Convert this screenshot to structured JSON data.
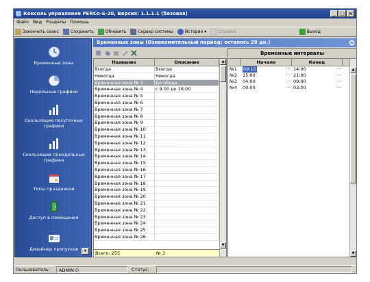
{
  "window": {
    "title": "Консоль управления PERCo-S-20, Версия: 1.1.1.1 (базовая)",
    "buttons": [
      "_",
      "□",
      "×"
    ]
  },
  "menu": [
    "Файл",
    "Вид",
    "Разделы",
    "Помощь"
  ],
  "toolbar": {
    "items": [
      {
        "label": "Закончить сеанс",
        "icon": "end-session-icon",
        "color": "#c2a15a"
      },
      {
        "label": "Сохранить",
        "icon": "save-icon",
        "color": "#5a6fb0"
      },
      {
        "label": "Обновить",
        "icon": "refresh-icon",
        "color": "#4aa04a"
      },
      {
        "label": "Сервер системы",
        "icon": "server-icon",
        "color": "#5e6e8a"
      },
      {
        "label": "История",
        "icon": "history-icon",
        "color": "#3a66b8"
      },
      {
        "label": "Справка",
        "icon": "help-icon",
        "color": "#b5b5b5",
        "disabled": true
      }
    ],
    "exit_label": "Выход"
  },
  "sidebar": {
    "items": [
      {
        "label": "Временные зоны",
        "icon": "clock-icon"
      },
      {
        "label": "Недельные графики",
        "icon": "pie-chart-icon"
      },
      {
        "label": "Скользящие посуточные графики",
        "icon": "bar-chart-icon"
      },
      {
        "label": "Скользящие понедельные графики",
        "icon": "bar-chart-icon"
      },
      {
        "label": "Типы праздников",
        "icon": "holiday-icon"
      },
      {
        "label": "Доступ в помещения",
        "icon": "door-icon"
      },
      {
        "label": "Дизайнер пропусков",
        "icon": "card-designer-icon"
      }
    ]
  },
  "panel": {
    "header": "Временные зоны (Ознакомительный период: осталось 29 дн.)"
  },
  "zones_table": {
    "columns": [
      "Название",
      "Описание"
    ],
    "rows": [
      {
        "name": "Всегда",
        "description": "Всегда"
      },
      {
        "name": "Никогда",
        "description": "Никогда"
      },
      {
        "name": "Временная зона №  3",
        "description": "До обеда",
        "selected": true
      },
      {
        "name": "Временная зона №  4",
        "description": "с 9.00 до 18.00"
      },
      {
        "name": "Временная зона №  5",
        "description": ""
      },
      {
        "name": "Временная зона №  6",
        "description": ""
      },
      {
        "name": "Временная зона №  7",
        "description": ""
      },
      {
        "name": "Временная зона №  8",
        "description": ""
      },
      {
        "name": "Временная зона №  9",
        "description": ""
      },
      {
        "name": "Временная зона № 10",
        "description": ""
      },
      {
        "name": "Временная зона № 11",
        "description": ""
      },
      {
        "name": "Временная зона № 12",
        "description": ""
      },
      {
        "name": "Временная зона № 13",
        "description": ""
      },
      {
        "name": "Временная зона № 14",
        "description": ""
      },
      {
        "name": "Временная зона № 15",
        "description": ""
      },
      {
        "name": "Временная зона № 16",
        "description": ""
      },
      {
        "name": "Временная зона № 17",
        "description": ""
      },
      {
        "name": "Временная зона № 18",
        "description": ""
      },
      {
        "name": "Временная зона № 19",
        "description": ""
      },
      {
        "name": "Временная зона № 20",
        "description": ""
      },
      {
        "name": "Временная зона № 21",
        "description": ""
      },
      {
        "name": "Временная зона № 22",
        "description": ""
      },
      {
        "name": "Временная зона № 23",
        "description": ""
      },
      {
        "name": "Временная зона № 24",
        "description": ""
      },
      {
        "name": "Временная зона № 25",
        "description": ""
      },
      {
        "name": "Временная зона № 26",
        "description": ""
      }
    ],
    "footer_total": "Всего: 255",
    "footer_current": "№ 3"
  },
  "intervals": {
    "title": "Временные интервалы",
    "columns": [
      "Начало",
      "Конец"
    ],
    "rows": [
      {
        "num": "№1",
        "start": "09:10",
        "end": "14:00"
      },
      {
        "num": "№2",
        "start": "15:00",
        "end": "21:00"
      },
      {
        "num": "№3",
        "start": "04:00",
        "end": "09:00"
      },
      {
        "num": "№4",
        "start": "00:00",
        "end": "03:00"
      }
    ]
  },
  "statusbar": {
    "user_label": "Пользователь:",
    "user_value": "ADMIN ()",
    "status_label": "Статус:",
    "status_value": ""
  },
  "watermark": "COM"
}
